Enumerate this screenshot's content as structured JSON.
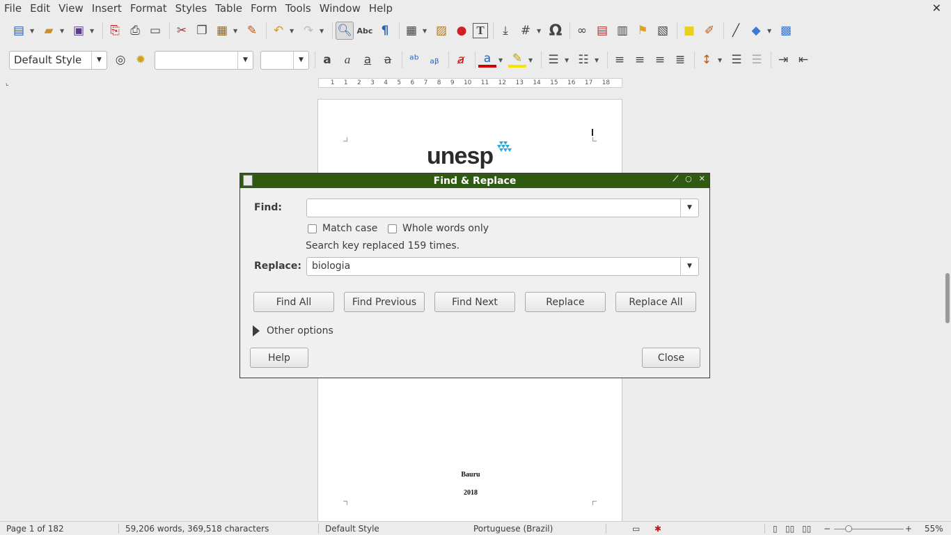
{
  "menu": {
    "items": [
      "File",
      "Edit",
      "View",
      "Insert",
      "Format",
      "Styles",
      "Table",
      "Form",
      "Tools",
      "Window",
      "Help"
    ],
    "close_glyph": "✕"
  },
  "formatting": {
    "paragraph_style": "Default Style",
    "font_name": "",
    "font_size": ""
  },
  "ruler": {
    "marks": [
      "1",
      "1",
      "2",
      "3",
      "4",
      "5",
      "6",
      "7",
      "8",
      "9",
      "10",
      "11",
      "12",
      "13",
      "14",
      "15",
      "16",
      "17",
      "18"
    ]
  },
  "document": {
    "logo_text": "unesp",
    "city": "Bauru",
    "year": "2018"
  },
  "dialog": {
    "title": "Find & Replace",
    "find_label": "Find:",
    "find_value": "",
    "match_case_label": "Match case",
    "match_case_checked": false,
    "whole_words_label": "Whole words only",
    "whole_words_checked": false,
    "status_message": "Search key replaced 159 times.",
    "replace_label": "Replace:",
    "replace_value": "biologia",
    "buttons": {
      "find_all": "Find All",
      "find_previous": "Find Previous",
      "find_next": "Find Next",
      "replace": "Replace",
      "replace_all": "Replace All"
    },
    "other_options_label": "Other options",
    "help_label": "Help",
    "close_label": "Close"
  },
  "statusbar": {
    "page_info": "Page 1 of 182",
    "word_count": "59,206 words, 369,518 characters",
    "page_style": "Default Style",
    "language": "Portuguese (Brazil)",
    "zoom": "55%"
  },
  "colors": {
    "dialog_title_bg": "#2f5a12",
    "font_color_accent": "#cc0000",
    "highlight_accent": "#f5e400",
    "logo_mark": "#29a8d8"
  }
}
